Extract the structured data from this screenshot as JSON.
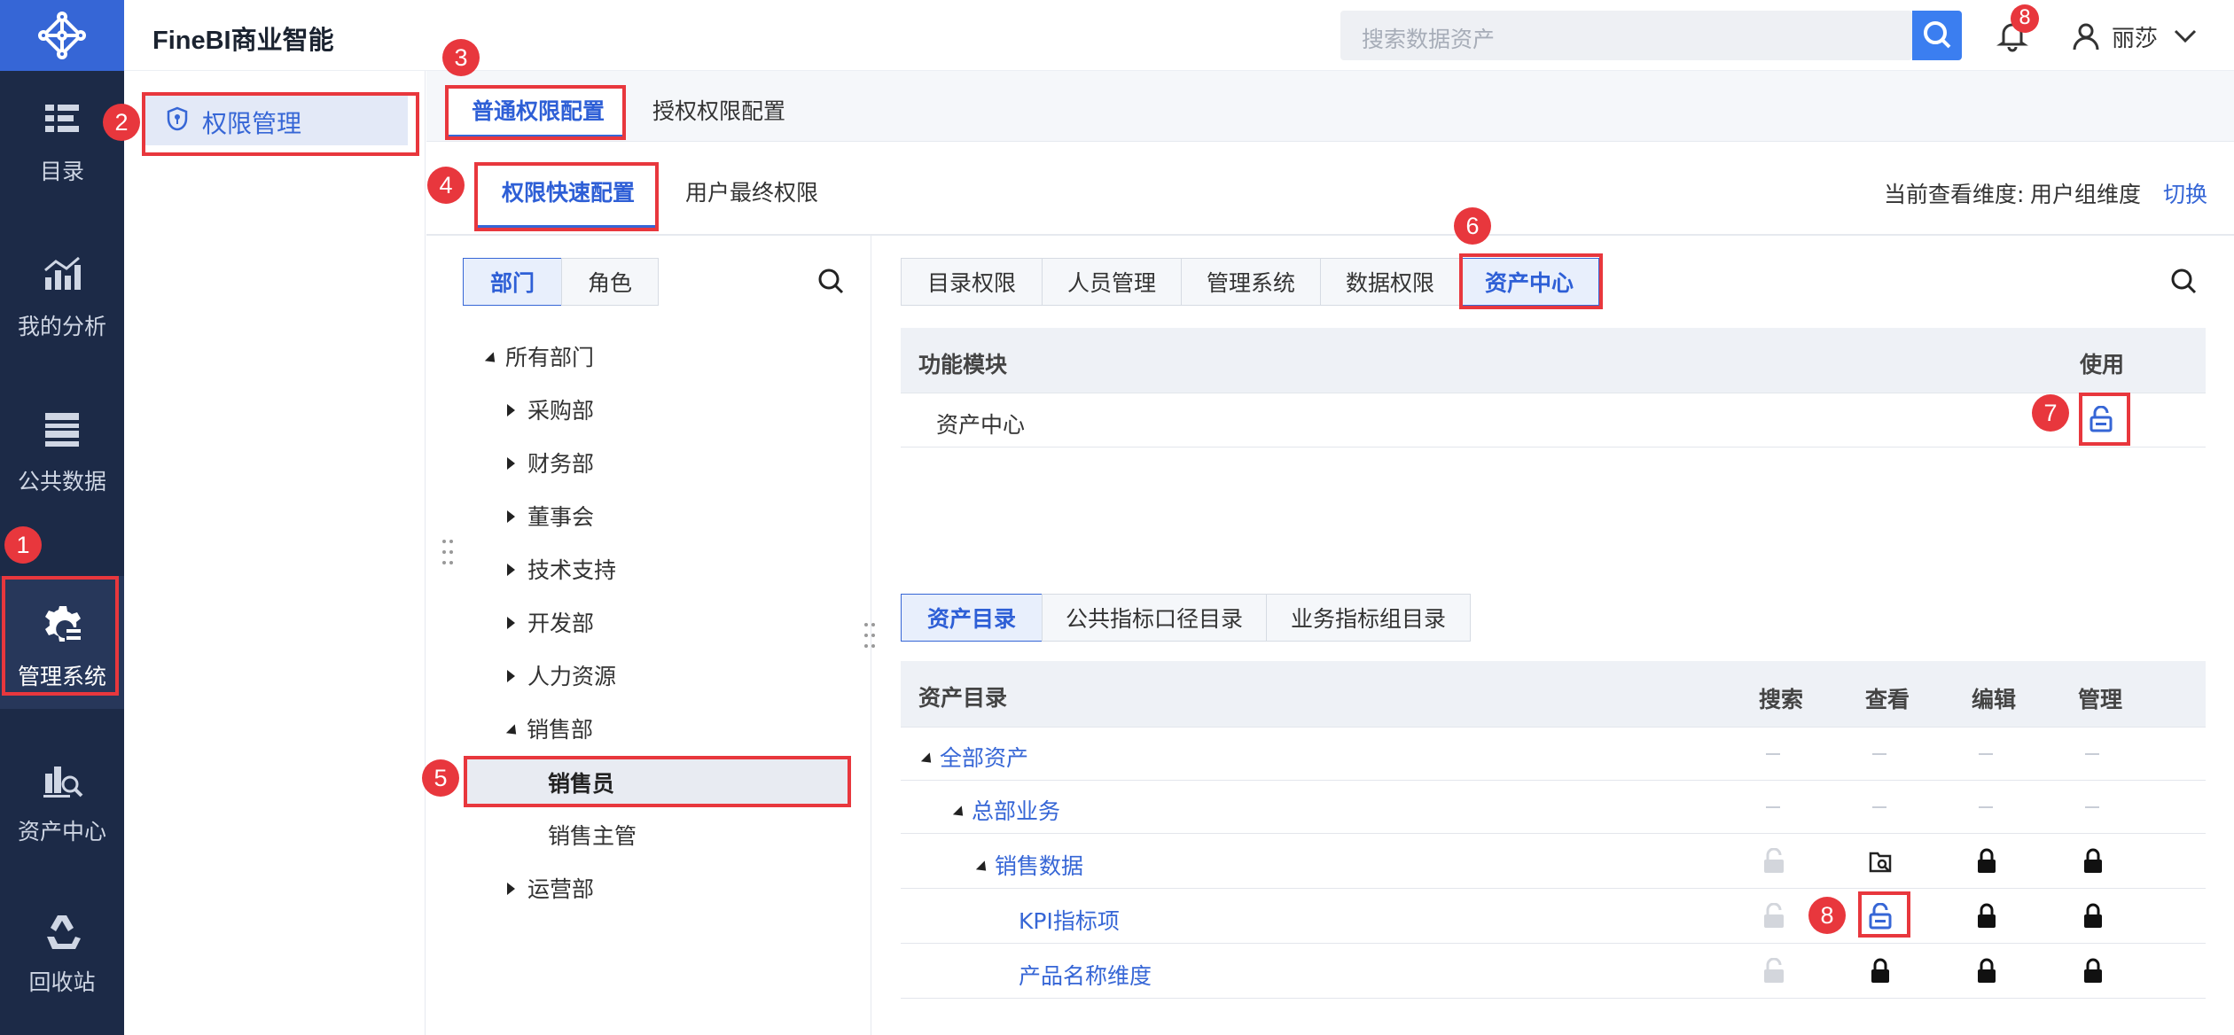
{
  "app": {
    "title": "FineBI商业智能"
  },
  "search": {
    "placeholder": "搜索数据资产"
  },
  "notifications": {
    "count": "8"
  },
  "user": {
    "name": "丽莎"
  },
  "leftnav": [
    {
      "label": "目录",
      "icon": "catalog-icon"
    },
    {
      "label": "我的分析",
      "icon": "analysis-icon"
    },
    {
      "label": "公共数据",
      "icon": "public-data-icon"
    },
    {
      "label": "管理系统",
      "icon": "gear-icon"
    },
    {
      "label": "资产中心",
      "icon": "asset-center-icon"
    },
    {
      "label": "回收站",
      "icon": "recycle-icon"
    }
  ],
  "sidebar": {
    "item": "权限管理"
  },
  "tabs": {
    "tab1": "普通权限配置",
    "tab2": "授权权限配置"
  },
  "subtabs": {
    "tab1": "权限快速配置",
    "tab2": "用户最终权限"
  },
  "view_dimension": {
    "label": "当前查看维度:",
    "value": "用户组维度",
    "switch": "切换"
  },
  "seg_left": {
    "dept": "部门",
    "role": "角色"
  },
  "tree": {
    "root": "所有部门",
    "items": [
      "采购部",
      "财务部",
      "董事会",
      "技术支持",
      "开发部",
      "人力资源",
      "销售部"
    ],
    "sales_children": [
      "销售员",
      "销售主管"
    ],
    "last": "运营部"
  },
  "perm_tabs": [
    "目录权限",
    "人员管理",
    "管理系统",
    "数据权限",
    "资产中心"
  ],
  "func_table": {
    "col1": "功能模块",
    "col2": "使用",
    "row": "资产中心"
  },
  "asset_tabs": [
    "资产目录",
    "公共指标口径目录",
    "业务指标组目录"
  ],
  "asset_table": {
    "headers": [
      "资产目录",
      "搜索",
      "查看",
      "编辑",
      "管理"
    ],
    "rows": [
      "全部资产",
      "总部业务",
      "销售数据",
      "KPI指标项",
      "产品名称维度"
    ]
  },
  "badges": [
    "1",
    "2",
    "3",
    "4",
    "5",
    "6",
    "7",
    "8"
  ],
  "colors": {
    "accent": "#3666d6",
    "nav_bg": "#1c2a47",
    "highlight": "#e8373d"
  }
}
